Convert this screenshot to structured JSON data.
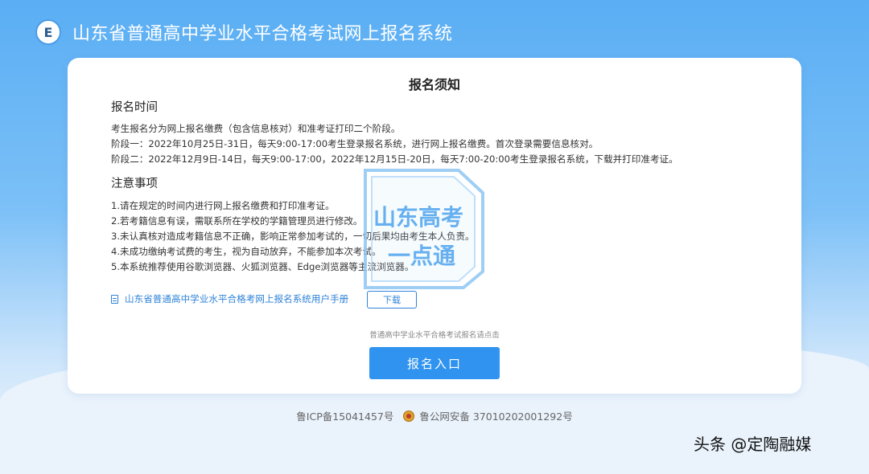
{
  "header": {
    "logo_letter": "E",
    "title": "山东省普通高中学业水平合格考试网上报名系统"
  },
  "card": {
    "title": "报名须知",
    "section1": {
      "title": "报名时间",
      "lines": [
        "考生报名分为网上报名缴费（包含信息核对）和准考证打印二个阶段。",
        "阶段一：2022年10月25日-31日，每天9:00-17:00考生登录报名系统，进行网上报名缴费。首次登录需要信息核对。",
        "阶段二：2022年12月9日-14日，每天9:00-17:00，2022年12月15日-20日，每天7:00-20:00考生登录报名系统，下载并打印准考证。"
      ]
    },
    "section2": {
      "title": "注意事项",
      "lines": [
        "1.请在规定的时间内进行网上报名缴费和打印准考证。",
        "2.若考籍信息有误，需联系所在学校的学籍管理员进行修改。",
        "3.未认真核对造成考籍信息不正确，影响正常参加考试的，一切后果均由考生本人负责。",
        "4.未成功缴纳考试费的考生，视为自动放弃，不能参加本次考试。",
        "5.本系统推荐使用谷歌浏览器、火狐浏览器、Edge浏览器等主流浏览器。"
      ]
    },
    "manual": {
      "icon": "document-icon",
      "link": "山东省普通高中学业水平合格考网上报名系统用户手册",
      "download_label": "下载"
    },
    "hint": "普通高中学业水平合格考试报名请点击",
    "register_button": "报名入口"
  },
  "watermark": {
    "line1": "山东高考",
    "line2": "一点通"
  },
  "footer": {
    "icp": "鲁ICP备15041457号",
    "police_icon": "police-badge-icon",
    "police": "鲁公网安备 37010202001292号"
  },
  "brand": "头条 @定陶融媒",
  "colors": {
    "primary": "#2f93ef",
    "link": "#2f83d8",
    "header_bg": "#5aaef4"
  }
}
